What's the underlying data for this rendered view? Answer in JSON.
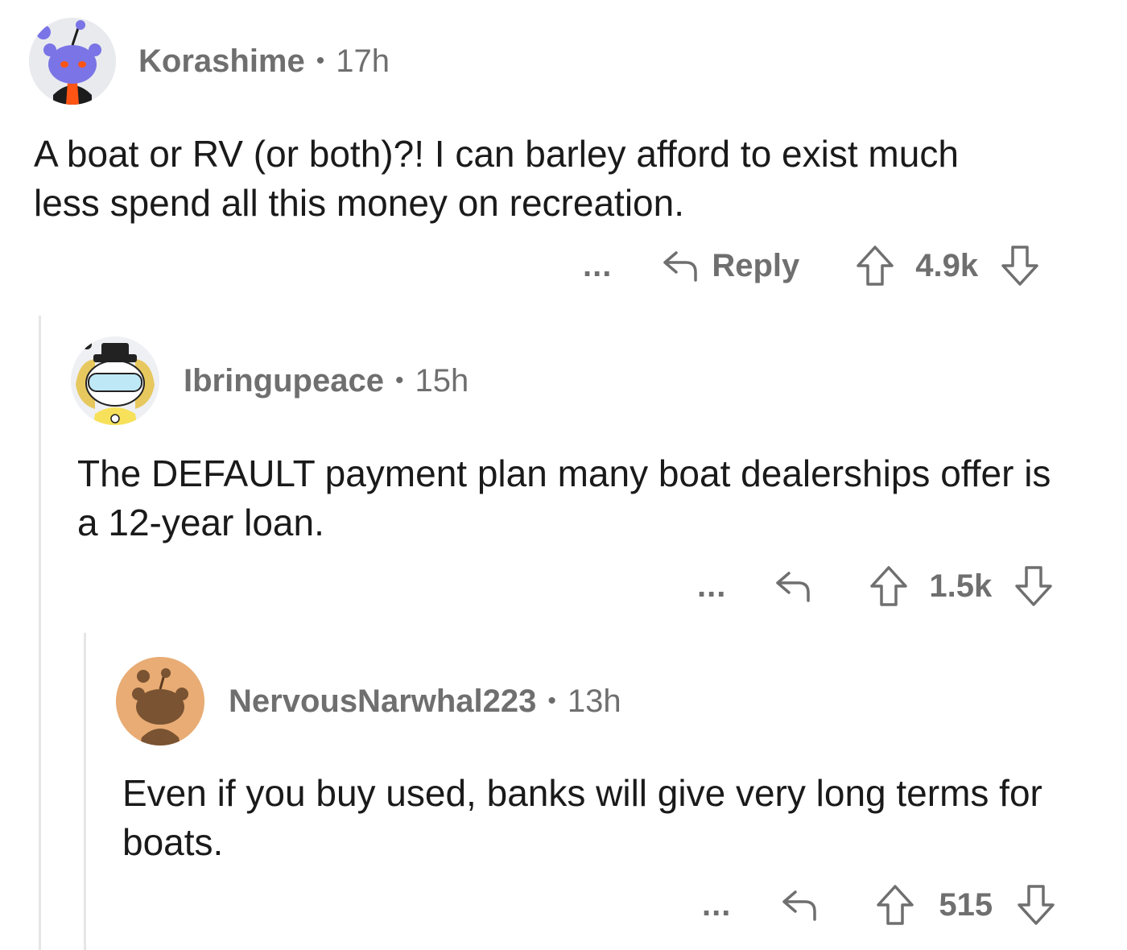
{
  "comments": [
    {
      "username": "Korashime",
      "separator": "•",
      "time": "17h",
      "text": "A boat or RV (or both)?! I can barley afford to exist much less spend all this money on recreation.",
      "more": "...",
      "reply_label": "Reply",
      "score": "4.9k",
      "avatar_bg": "#e9eaee"
    },
    {
      "username": "Ibringupeace",
      "separator": "•",
      "time": "15h",
      "text": "The DEFAULT payment plan many boat dealerships offer is a 12-year loan.",
      "more": "...",
      "score": "1.5k",
      "avatar_bg": "#eef0f3"
    },
    {
      "username": "NervousNarwhal223",
      "separator": "•",
      "time": "13h",
      "text": "Even if you buy used, banks will give very long terms for boats.",
      "more": "...",
      "score": "515",
      "avatar_bg": "#e8ac74"
    }
  ],
  "icons": {
    "reply": "reply-arrow-icon",
    "upvote": "upvote-arrow-icon",
    "downvote": "downvote-arrow-icon"
  },
  "colors": {
    "text": "#1a1a1b",
    "meta": "#6f6f6f",
    "thread_line": "#e6e6e6"
  }
}
